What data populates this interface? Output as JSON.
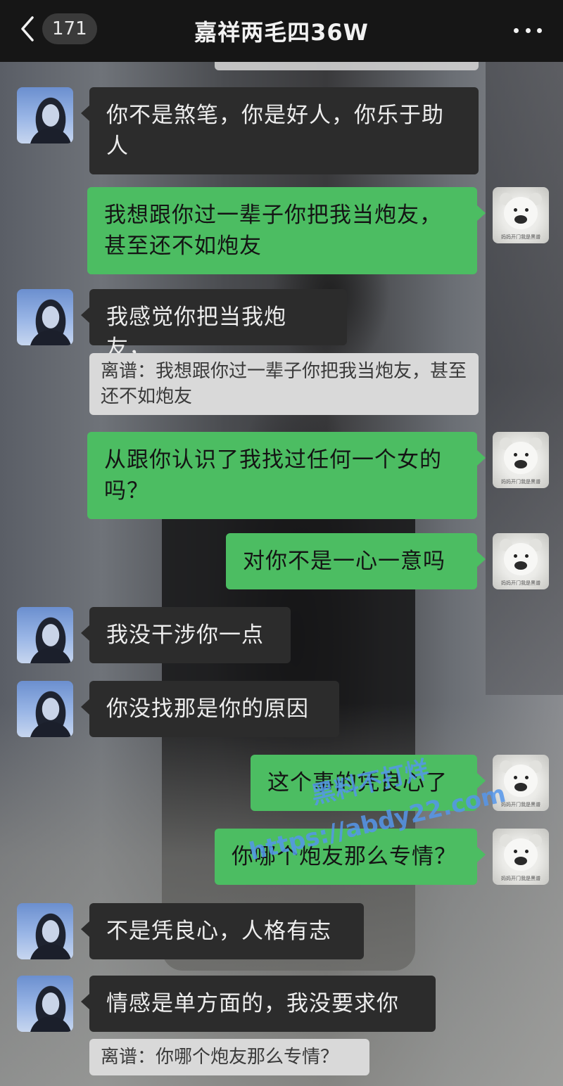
{
  "header": {
    "unread_count": "171",
    "title": "嘉祥两毛四36W"
  },
  "messages": [
    {
      "side": "in",
      "text": "你不是煞笔，你是好人，你乐于助人"
    },
    {
      "side": "out",
      "text": "我想跟你过一辈子你把我当炮友，甚至还不如炮友"
    },
    {
      "side": "in",
      "text": "我感觉你把当我炮友，",
      "quote": "离谱：我想跟你过一辈子你把我当炮友，甚至还不如炮友"
    },
    {
      "side": "out",
      "text": "从跟你认识了我找过任何一个女的吗？"
    },
    {
      "side": "out",
      "text": "对你不是一心一意吗"
    },
    {
      "side": "in",
      "text": "我没干涉你一点"
    },
    {
      "side": "in",
      "text": "你没找那是你的原因"
    },
    {
      "side": "out",
      "text": "这个事的凭良心了"
    },
    {
      "side": "out",
      "text": "你哪个炮友那么专情？"
    },
    {
      "side": "in",
      "text": "不是凭良心，人格有志"
    },
    {
      "side": "in",
      "text": "情感是单方面的，我没要求你",
      "quote": "离谱：你哪个炮友那么专情？"
    }
  ],
  "self_avatar_caption": "妈妈开门我是黑谱",
  "watermark": {
    "line1": "黑料不打烊",
    "line2": "https://abdy22.com"
  },
  "colors": {
    "header_bg": "#161616",
    "incoming_bubble": "#2c2c2c",
    "outgoing_bubble": "#4cbd62",
    "quote_bg": "#d9d9d9",
    "watermark": "#5596eb"
  }
}
